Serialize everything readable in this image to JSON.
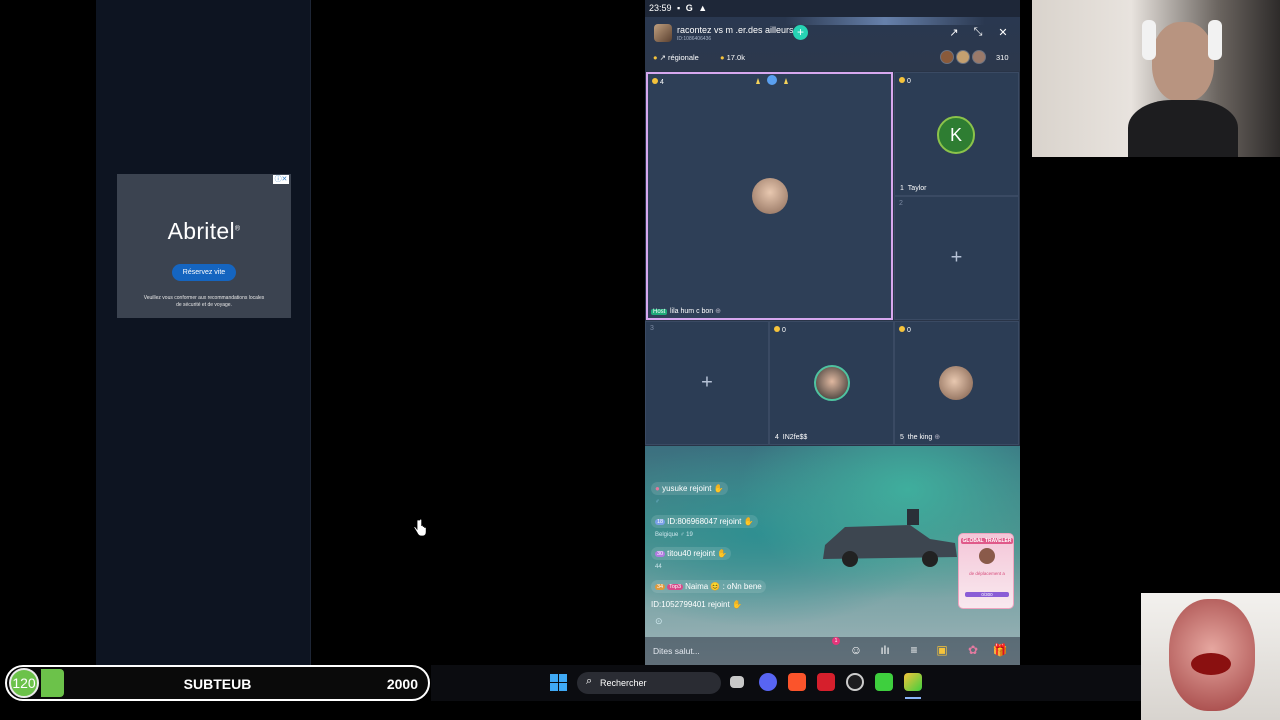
{
  "ad": {
    "brand": "Abritel",
    "brand_mark": "®",
    "cta": "Réservez vite",
    "note_line1": "Veuillez vous conformer aux recommandations locales",
    "note_line2": "de sécurité et de voyage.",
    "choice_icon": "adchoices-icon"
  },
  "status_bar": {
    "time": "23:59",
    "icons": [
      "notification-icon",
      "g-icon",
      "warning-icon"
    ]
  },
  "room": {
    "title": "racontez vs m .er.des ailleurs",
    "id": "ID:1086406436",
    "region": "↗ régionale",
    "coins": "17.0k",
    "viewer_count": "310"
  },
  "seats": {
    "host": {
      "coins": "4",
      "badge": "Host",
      "name": "lila hum c bon"
    },
    "s1": {
      "coins": "0",
      "num": "1",
      "name": "Taylor",
      "initial": "K"
    },
    "s2": {
      "num": "2",
      "plus": "+"
    },
    "s3": {
      "num": "3",
      "plus": "+"
    },
    "s4": {
      "coins": "0",
      "num": "4",
      "name": "IN2fe$$"
    },
    "s5": {
      "coins": "0",
      "num": "5",
      "name": "the king"
    }
  },
  "chat": [
    {
      "text": "yusuke rejoint"
    },
    {
      "level": "18",
      "text": "ID:806968047 rejoint",
      "sub": "Belgique   ♂ 19"
    },
    {
      "level": "30",
      "text": "titou40 rejoint",
      "sub": "44"
    },
    {
      "level": "34",
      "badge": "Top3",
      "text": "Naima 😊 : oNn bene"
    },
    {
      "text": "ID:1052799401 rejoint"
    }
  ],
  "event": {
    "title": "GLOBAL TRAVELER",
    "sub": "de déplacement a",
    "ratio": "0/300",
    "badge": "1"
  },
  "input": {
    "placeholder": "Dites salut..."
  },
  "subgoal": {
    "count": "120",
    "label": "SUBTEUB",
    "target": "2000",
    "progress": 0.06,
    "color": "#6cc24a"
  },
  "taskbar": {
    "search_label": "Rechercher"
  }
}
